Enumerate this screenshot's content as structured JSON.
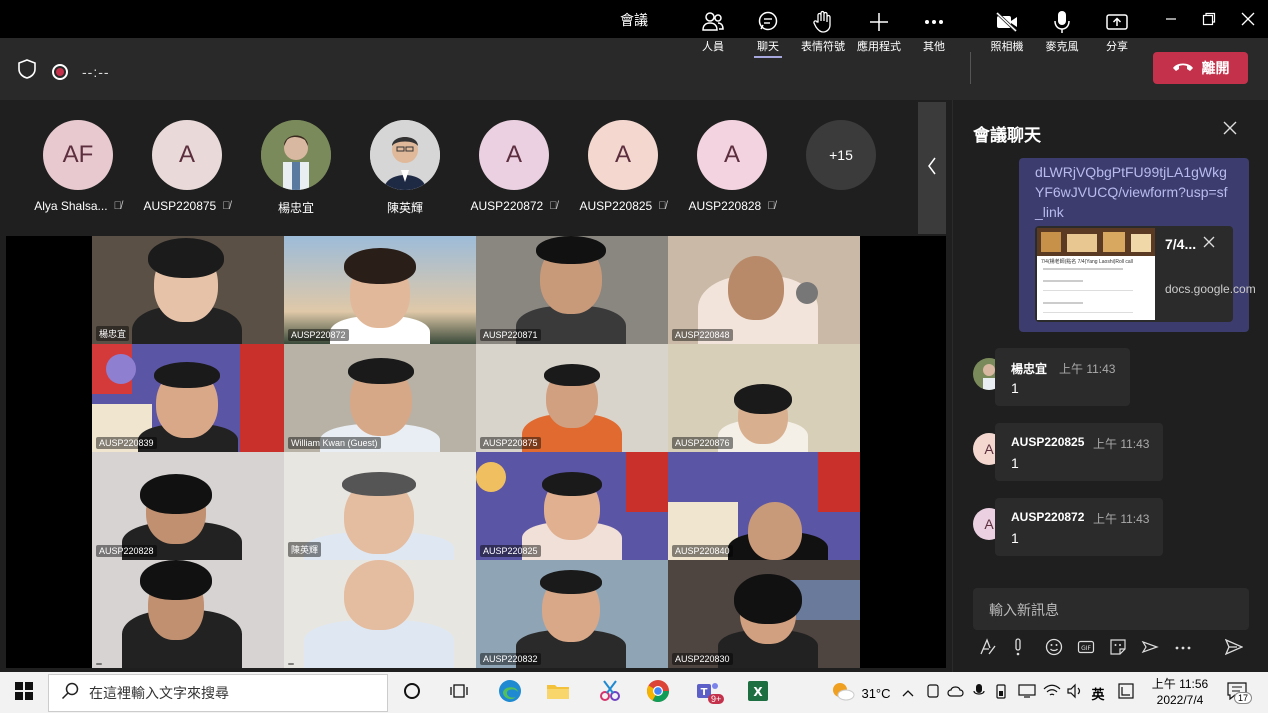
{
  "window": {
    "title": "會議"
  },
  "toolbar": {
    "timer": "--:--",
    "buttons": {
      "people": "人員",
      "chat": "聊天",
      "reactions": "表情符號",
      "apps": "應用程式",
      "more": "其他",
      "camera": "照相機",
      "mic": "麥克風",
      "share": "分享"
    },
    "leave_label": "離開"
  },
  "colors": {
    "leave": "#c4314b",
    "accent": "#a6a7dc",
    "link": "#b9bbef",
    "my_message": "#3c3c6e"
  },
  "strip": {
    "participants": [
      {
        "initials": "AF",
        "name": "Alya Shalsa...",
        "muted": true,
        "avatar_color": "#e7c9cf"
      },
      {
        "initials": "A",
        "name": "AUSP220875",
        "muted": true,
        "avatar_color": "#e9dad9"
      },
      {
        "initials": "",
        "name": "楊忠宜",
        "muted": false,
        "avatar_color": "#6c7a5a"
      },
      {
        "initials": "",
        "name": "陳英輝",
        "muted": false,
        "avatar_color": "#c9c9c9"
      },
      {
        "initials": "A",
        "name": "AUSP220872",
        "muted": true,
        "avatar_color": "#ead0e0"
      },
      {
        "initials": "A",
        "name": "AUSP220825",
        "muted": true,
        "avatar_color": "#f4d8d0"
      },
      {
        "initials": "A",
        "name": "AUSP220828",
        "muted": true,
        "avatar_color": "#f2d3df"
      }
    ],
    "overflow_count": "+15"
  },
  "grid": {
    "tiles": [
      {
        "label": "楊忠宜",
        "bg": "#5a5046"
      },
      {
        "label": "AUSP220872",
        "bg": "#7fa3c4"
      },
      {
        "label": "AUSP220871",
        "bg": "#8a8680"
      },
      {
        "label": "AUSP220848",
        "bg": "#c9b9a6"
      },
      {
        "label": "AUSP220839",
        "bg": "#5b55a5"
      },
      {
        "label": "William Kwan (Guest)",
        "bg": "#b8b2a6"
      },
      {
        "label": "AUSP220875",
        "bg": "#d9d4cb"
      },
      {
        "label": "AUSP220876",
        "bg": "#d8cfb8"
      },
      {
        "label": "AUSP220828",
        "bg": "#d8d3d3"
      },
      {
        "label": "陳英輝",
        "bg": "#e8e6e1"
      },
      {
        "label": "AUSP220825",
        "bg": "#5b55a5"
      },
      {
        "label": "AUSP220840",
        "bg": "#5b55a5"
      },
      {
        "label": "",
        "bg": "#d8d3d3"
      },
      {
        "label": "",
        "bg": "#e8e6e1"
      },
      {
        "label": "AUSP220832",
        "bg": "#8fa5b5"
      },
      {
        "label": "AUSP220830",
        "bg": "#4e4440"
      }
    ]
  },
  "chat": {
    "title": "會議聊天",
    "link_text": "dLWRjVQbgPtFU99tjLA1gWkgYF6wJVUCQ/viewform?usp=sf_link",
    "card": {
      "title": "7/4...",
      "domain": "docs.google.com",
      "thumb_caption": "7/4(楊老師)點名 7/4(Yang Laoshi)Roll call"
    },
    "messages": [
      {
        "sender": "楊忠宜",
        "time": "上午 11:43",
        "text": "1",
        "initials": ""
      },
      {
        "sender": "AUSP220825",
        "time": "上午 11:43",
        "text": "1",
        "initials": "A"
      },
      {
        "sender": "AUSP220872",
        "time": "上午 11:43",
        "text": "1",
        "initials": "A"
      }
    ],
    "compose_placeholder": "輸入新訊息"
  },
  "taskbar": {
    "search_placeholder": "在這裡輸入文字來搜尋",
    "teams_badge": "9+",
    "weather": "31°C",
    "ime": "英",
    "time": "上午 11:56",
    "date": "2022/7/4",
    "notification_count": "17"
  }
}
